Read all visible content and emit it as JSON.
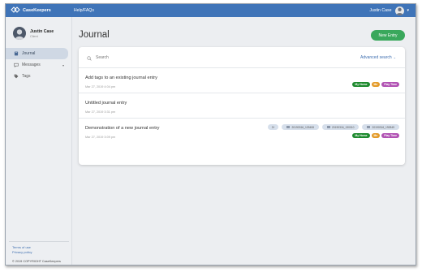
{
  "app": {
    "name": "CaseKeepers"
  },
  "topbar": {
    "help_link": "Help/FAQs",
    "user_name": "Justin Case",
    "caret": "▾"
  },
  "sidebar": {
    "profile": {
      "name": "Justin Case",
      "role": "Client"
    },
    "items": [
      {
        "label": "Journal",
        "icon": "book-icon",
        "active": true
      },
      {
        "label": "Messages",
        "icon": "chat-icon",
        "active": false,
        "chevron": "▾"
      },
      {
        "label": "Tags",
        "icon": "tag-icon",
        "active": false
      }
    ],
    "footer": {
      "terms": "Terms of use",
      "privacy": "Privacy policy",
      "copyright": "© 2019 COPYRIGHT CaseKeepers"
    }
  },
  "main": {
    "title": "Journal",
    "new_entry_label": "New Entry",
    "search": {
      "placeholder": "Search",
      "advanced_label": "Advanced search",
      "advanced_arrow": "⌄"
    },
    "entries": [
      {
        "title": "Add tags to an existing journal entry",
        "date": "Mar 27, 2019 4:04 pm",
        "tags": [
          {
            "label": "My Home",
            "color": "#1e8a2e"
          },
          {
            "label": "Me",
            "color": "#e39a28"
          },
          {
            "label": "Play Time",
            "color": "#b152b3"
          }
        ]
      },
      {
        "title": "Untitled journal entry",
        "date": "Mar 27, 2019 3:31 pm",
        "tags": []
      },
      {
        "title": "Demonstration of a new journal entry",
        "date": "Mar 27, 2019 3:09 pm",
        "attachments": {
          "more": "3+",
          "files": [
            "20190316_125408",
            "20190316_130010",
            "20190316_192849"
          ]
        },
        "tags": [
          {
            "label": "My Home",
            "color": "#1e8a2e"
          },
          {
            "label": "Me",
            "color": "#e39a28"
          },
          {
            "label": "Play Time",
            "color": "#b152b3"
          }
        ]
      }
    ]
  },
  "colors": {
    "topbar": "#3f74b8",
    "accent_green": "#3aa85c",
    "link_blue": "#3f6fb0",
    "active_nav": "#cfd8e4"
  }
}
